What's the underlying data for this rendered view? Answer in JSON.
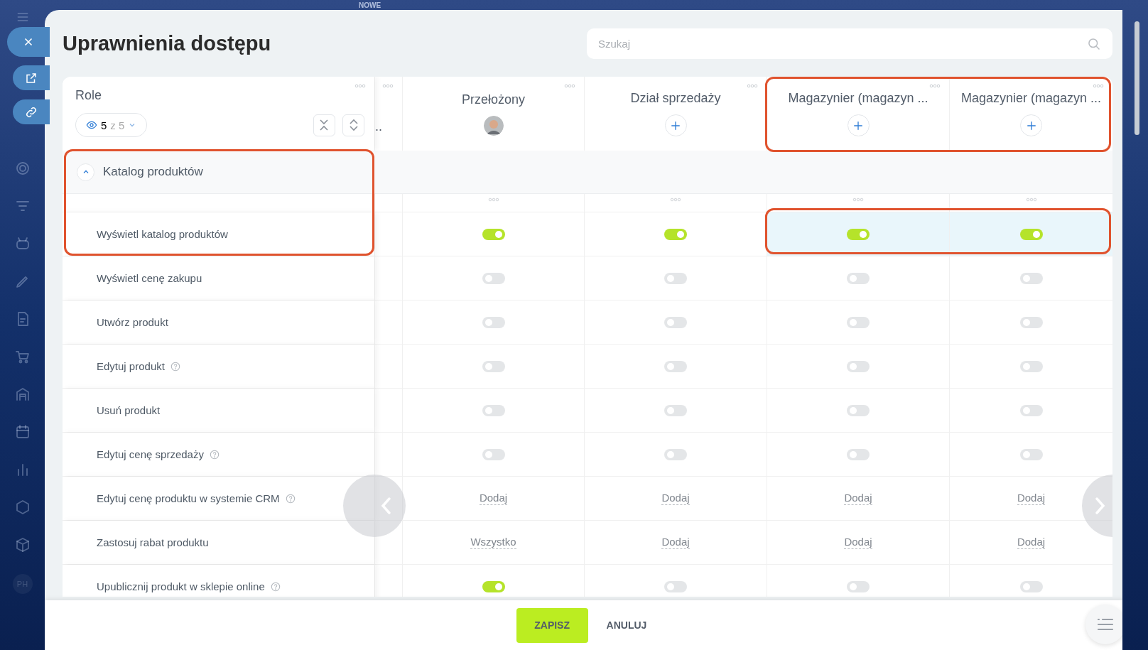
{
  "sidebar": {
    "badge": "NOWE",
    "avatar_initials": "PH"
  },
  "title": "Uprawnienia dostępu",
  "search": {
    "placeholder": "Szukaj"
  },
  "roles_header": {
    "label": "Role",
    "visible_count": "5",
    "of": "z 5"
  },
  "columns": [
    {
      "title": "..",
      "kind": "partial",
      "framed": false
    },
    {
      "title": "Przełożony",
      "kind": "avatar",
      "framed": false
    },
    {
      "title": "Dział sprzedaży",
      "kind": "add",
      "framed": false
    },
    {
      "title": "Magazynier (magazyn ...",
      "kind": "add",
      "framed": true
    },
    {
      "title": "Magazynier (magazyn ...",
      "kind": "add",
      "framed": true
    }
  ],
  "section": {
    "title": "Katalog produktów",
    "expanded": true,
    "framed": true
  },
  "rows": [
    {
      "label": "Wyświetl katalog produktów",
      "help": false,
      "cells": [
        {
          "kind": "toggle",
          "on": true,
          "highlighted": false
        },
        {
          "kind": "toggle",
          "on": true,
          "highlighted": false
        },
        {
          "kind": "toggle",
          "on": true,
          "highlighted": true
        },
        {
          "kind": "toggle",
          "on": true,
          "highlighted": true
        }
      ]
    },
    {
      "label": "Wyświetl cenę zakupu",
      "help": false,
      "cells": [
        {
          "kind": "toggle",
          "on": false,
          "highlighted": false
        },
        {
          "kind": "toggle",
          "on": false,
          "highlighted": false
        },
        {
          "kind": "toggle",
          "on": false,
          "highlighted": false
        },
        {
          "kind": "toggle",
          "on": false,
          "highlighted": false
        }
      ]
    },
    {
      "label": "Utwórz produkt",
      "help": false,
      "cells": [
        {
          "kind": "toggle",
          "on": false,
          "highlighted": false
        },
        {
          "kind": "toggle",
          "on": false,
          "highlighted": false
        },
        {
          "kind": "toggle",
          "on": false,
          "highlighted": false
        },
        {
          "kind": "toggle",
          "on": false,
          "highlighted": false
        }
      ]
    },
    {
      "label": "Edytuj produkt",
      "help": true,
      "cells": [
        {
          "kind": "toggle",
          "on": false,
          "highlighted": false
        },
        {
          "kind": "toggle",
          "on": false,
          "highlighted": false
        },
        {
          "kind": "toggle",
          "on": false,
          "highlighted": false
        },
        {
          "kind": "toggle",
          "on": false,
          "highlighted": false
        }
      ]
    },
    {
      "label": "Usuń produkt",
      "help": false,
      "cells": [
        {
          "kind": "toggle",
          "on": false,
          "highlighted": false
        },
        {
          "kind": "toggle",
          "on": false,
          "highlighted": false
        },
        {
          "kind": "toggle",
          "on": false,
          "highlighted": false
        },
        {
          "kind": "toggle",
          "on": false,
          "highlighted": false
        }
      ]
    },
    {
      "label": "Edytuj cenę sprzedaży",
      "help": true,
      "cells": [
        {
          "kind": "toggle",
          "on": false,
          "highlighted": false
        },
        {
          "kind": "toggle",
          "on": false,
          "highlighted": false
        },
        {
          "kind": "toggle",
          "on": false,
          "highlighted": false
        },
        {
          "kind": "toggle",
          "on": false,
          "highlighted": false
        }
      ]
    },
    {
      "label": "Edytuj cenę produktu w systemie CRM",
      "help": true,
      "cells": [
        {
          "kind": "link",
          "text": "Dodaj",
          "highlighted": false
        },
        {
          "kind": "link",
          "text": "Dodaj",
          "highlighted": false
        },
        {
          "kind": "link",
          "text": "Dodaj",
          "highlighted": false
        },
        {
          "kind": "link",
          "text": "Dodaj",
          "highlighted": false
        }
      ]
    },
    {
      "label": "Zastosuj rabat produktu",
      "help": false,
      "cells": [
        {
          "kind": "link",
          "text": "Wszystko",
          "highlighted": false
        },
        {
          "kind": "link",
          "text": "Dodaj",
          "highlighted": false
        },
        {
          "kind": "link",
          "text": "Dodaj",
          "highlighted": false
        },
        {
          "kind": "link",
          "text": "Dodaj",
          "highlighted": false
        }
      ]
    },
    {
      "label": "Upublicznij produkt w sklepie online",
      "help": true,
      "cells": [
        {
          "kind": "toggle",
          "on": true,
          "highlighted": false
        },
        {
          "kind": "toggle",
          "on": false,
          "highlighted": false
        },
        {
          "kind": "toggle",
          "on": false,
          "highlighted": false
        },
        {
          "kind": "toggle",
          "on": false,
          "highlighted": false
        }
      ]
    }
  ],
  "footer": {
    "save": "ZAPISZ",
    "cancel": "ANULUJ"
  }
}
